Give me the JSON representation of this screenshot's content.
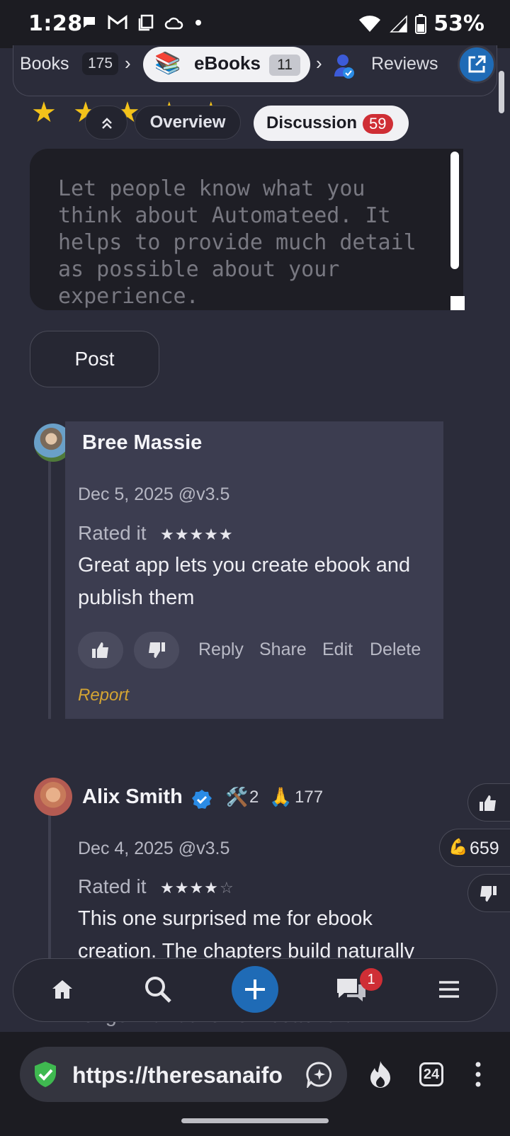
{
  "status_bar": {
    "time": "1:28",
    "battery": "53%",
    "icons_left": [
      "chat-bubble-icon",
      "gmail-icon",
      "copy-icon",
      "cloud-icon",
      "dot-icon"
    ],
    "icons_right": [
      "wifi-icon",
      "signal-icon",
      "battery-icon"
    ]
  },
  "breadcrumb": {
    "books_label": "Books",
    "books_count": "175",
    "current_label": "eBooks",
    "current_count": "11",
    "reviews_label": "Reviews"
  },
  "rating_stars": "★ ★ ★ ★ ★",
  "tabs": {
    "overview": "Overview",
    "discussion": "Discussion",
    "discussion_count": "59"
  },
  "composer": {
    "placeholder": "Let people know what you think about Automateed. It helps to provide much detail as possible about your experience.",
    "post_label": "Post"
  },
  "comments": [
    {
      "author": "Bree Massie",
      "meta": "Dec 5, 2025 @v3.5",
      "rated_label": "Rated it",
      "stars": "★★★★★",
      "text": "Great app lets you create ebook and publish them",
      "actions": [
        "Reply",
        "Share",
        "Edit",
        "Delete"
      ],
      "report": "Report"
    },
    {
      "author": "Alix Smith",
      "tools_count": "2",
      "thanks_count": "177",
      "meta": "Dec 4, 2025 @v3.5",
      "rated_label": "Rated it",
      "stars": "★★★★",
      "stars_empty": "☆",
      "text": "This one surprised me for ebook creation. The chapters build naturally",
      "text_tail": "longer narrative flow better than"
    }
  ],
  "floating_actions": {
    "strength_count": "659"
  },
  "bottom_nav": {
    "items": [
      "home-icon",
      "search-icon",
      "add-icon",
      "chat-icon",
      "menu-icon"
    ],
    "chat_badge": "1"
  },
  "browser": {
    "url": "https://theresanaifo",
    "tab_count": "24"
  },
  "colors": {
    "background": "#2b2c3a",
    "accent": "#1f6bb6",
    "badge": "#cf2e35",
    "star": "#f3c21a",
    "report": "#d3a433"
  }
}
